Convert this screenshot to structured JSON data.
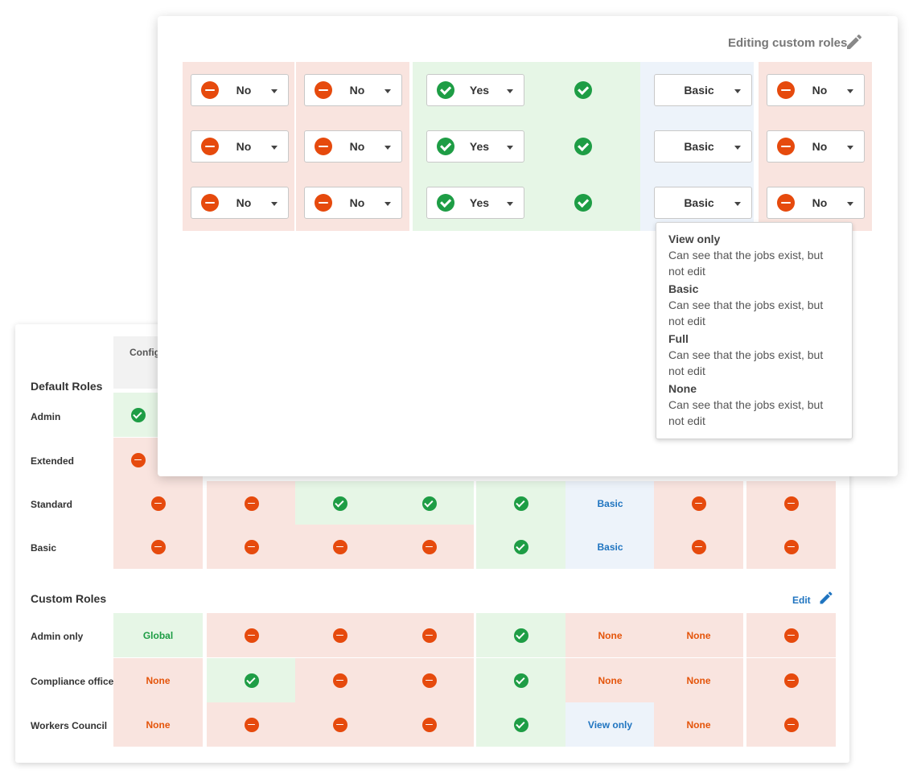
{
  "back_table": {
    "col_header": "Configure",
    "default_roles": {
      "title": "Default Roles",
      "rows": [
        {
          "label": "Admin"
        },
        {
          "label": "Extended"
        },
        {
          "label": "Standard",
          "cells": [
            "no",
            "no",
            "yes",
            "yes",
            "yes",
            "Basic",
            "no",
            "no"
          ]
        },
        {
          "label": "Basic",
          "cells": [
            "no",
            "no",
            "no",
            "no",
            "yes",
            "Basic",
            "no",
            "no"
          ]
        }
      ]
    },
    "custom_roles": {
      "title": "Custom Roles",
      "edit_label": "Edit",
      "rows": [
        {
          "label": "Admin only",
          "cells": [
            "Global",
            "no",
            "no",
            "no",
            "yes",
            "None",
            "None",
            "no"
          ]
        },
        {
          "label": "Compliance officer",
          "cells": [
            "None",
            "yes",
            "no",
            "no",
            "yes",
            "None",
            "None",
            "no"
          ]
        },
        {
          "label": "Workers Council",
          "cells": [
            "None",
            "no",
            "no",
            "no",
            "yes",
            "View only",
            "None",
            "no"
          ]
        }
      ]
    }
  },
  "editor": {
    "title": "Editing custom roles",
    "rows": [
      {
        "cells": [
          "No",
          "No",
          "Yes",
          "check",
          "Basic",
          "No"
        ]
      },
      {
        "cells": [
          "No",
          "No",
          "Yes",
          "check",
          "Basic",
          "No"
        ]
      },
      {
        "cells": [
          "No",
          "No",
          "Yes",
          "check",
          "Basic",
          "No"
        ]
      }
    ]
  },
  "tooltip": {
    "options": [
      {
        "title": "View only",
        "desc": "Can see that the jobs exist, but not edit"
      },
      {
        "title": "Basic",
        "desc": "Can see that the jobs exist, but not edit"
      },
      {
        "title": "Full",
        "desc": "Can see that the jobs exist, but not edit"
      },
      {
        "title": "None",
        "desc": "Can see that the jobs exist, but not edit"
      }
    ]
  },
  "colors": {
    "no_red": "#e64a0d",
    "yes_green": "#1e9d45",
    "link_blue": "#1f74c0"
  }
}
